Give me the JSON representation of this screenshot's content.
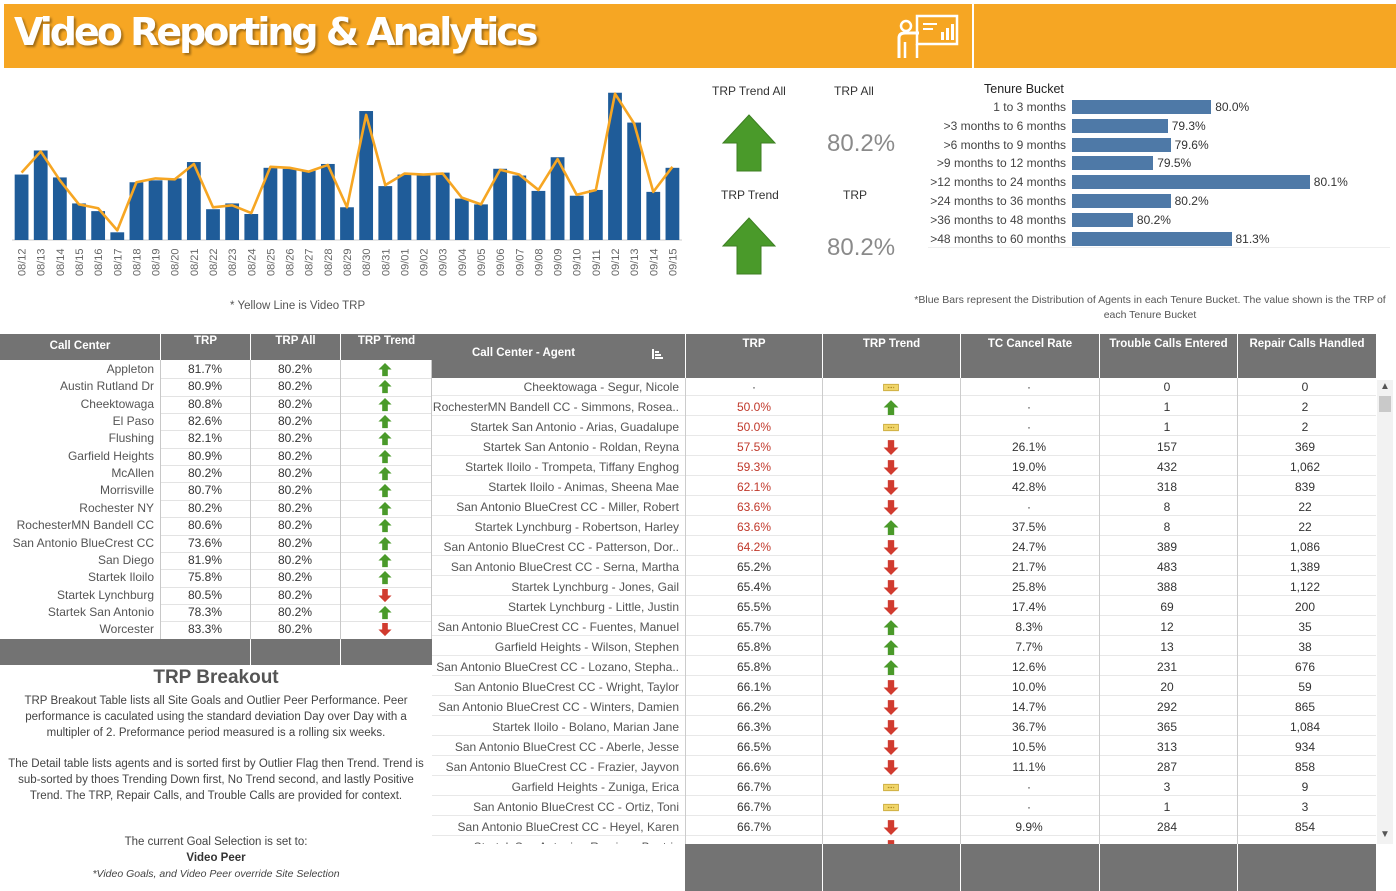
{
  "header": {
    "title": "Video Reporting & Analytics",
    "icon": "presentation-icon",
    "color": "#f6a623"
  },
  "trend_chart": {
    "note": "* Yellow Line is Video TRP",
    "bar_color": "#1f5c99",
    "line_color": "#f6a623",
    "dates": [
      "08/12",
      "08/13",
      "08/14",
      "08/15",
      "08/16",
      "08/17",
      "08/18",
      "08/19",
      "08/20",
      "08/21",
      "08/22",
      "08/23",
      "08/24",
      "08/25",
      "08/26",
      "08/27",
      "08/28",
      "08/29",
      "08/30",
      "08/31",
      "09/01",
      "09/02",
      "09/03",
      "09/04",
      "09/05",
      "09/06",
      "09/07",
      "09/08",
      "09/09",
      "09/10",
      "09/11",
      "09/12",
      "09/13",
      "09/14",
      "09/15"
    ],
    "bars": [
      68,
      93,
      65,
      38,
      30,
      8,
      60,
      62,
      64,
      81,
      32,
      38,
      27,
      75,
      74,
      72,
      79,
      34,
      134,
      56,
      68,
      68,
      70,
      43,
      37,
      74,
      67,
      51,
      86,
      46,
      52,
      153,
      122,
      50,
      75
    ],
    "line": [
      70,
      92,
      62,
      37,
      33,
      10,
      60,
      64,
      63,
      79,
      34,
      36,
      28,
      76,
      75,
      71,
      78,
      34,
      130,
      57,
      69,
      68,
      69,
      44,
      37,
      73,
      68,
      52,
      84,
      47,
      52,
      152,
      121,
      50,
      76
    ]
  },
  "kpis": {
    "trp_trend_all_label": "TRP Trend All",
    "trp_all_label": "TRP All",
    "trp_all_value": "80.2%",
    "trp_trend_label": "TRP Trend",
    "trp_label": "TRP",
    "trp_value": "80.2%"
  },
  "tenure": {
    "title": "Tenure Bucket",
    "note": "*Blue Bars represent the Distribution of Agents in each Tenure Bucket. The value shown is the TRP of each Tenure Bucket",
    "bar_color": "#4e79a7",
    "rows": [
      {
        "label": "1 to 3 months",
        "share": 0.48,
        "value": "80.0%"
      },
      {
        "label": ">3 months to 6 months",
        "share": 0.33,
        "value": "79.3%"
      },
      {
        "label": ">6 months to 9 months",
        "share": 0.34,
        "value": "79.6%"
      },
      {
        "label": ">9 months to 12 months",
        "share": 0.28,
        "value": "79.5%"
      },
      {
        "label": ">12 months  to 24 months",
        "share": 0.82,
        "value": "80.1%"
      },
      {
        "label": ">24 months to 36 months",
        "share": 0.34,
        "value": "80.2%"
      },
      {
        "label": ">36 months to 48 months",
        "share": 0.21,
        "value": "80.2%"
      },
      {
        "label": ">48 months to 60 months",
        "share": 0.55,
        "value": "81.3%"
      }
    ]
  },
  "call_center_table": {
    "headers": {
      "name": "Call Center",
      "trp": "TRP",
      "trp_all": "TRP All",
      "trend": "TRP Trend"
    },
    "rows": [
      {
        "name": "Appleton",
        "trp": "81.7%",
        "all": "80.2%",
        "trend": "up"
      },
      {
        "name": "Austin Rutland Dr",
        "trp": "80.9%",
        "all": "80.2%",
        "trend": "up"
      },
      {
        "name": "Cheektowaga",
        "trp": "80.8%",
        "all": "80.2%",
        "trend": "up"
      },
      {
        "name": "El Paso",
        "trp": "82.6%",
        "all": "80.2%",
        "trend": "up"
      },
      {
        "name": "Flushing",
        "trp": "82.1%",
        "all": "80.2%",
        "trend": "up"
      },
      {
        "name": "Garfield Heights",
        "trp": "80.9%",
        "all": "80.2%",
        "trend": "up"
      },
      {
        "name": "McAllen",
        "trp": "80.2%",
        "all": "80.2%",
        "trend": "up"
      },
      {
        "name": "Morrisville",
        "trp": "80.7%",
        "all": "80.2%",
        "trend": "up"
      },
      {
        "name": "Rochester NY",
        "trp": "80.2%",
        "all": "80.2%",
        "trend": "up"
      },
      {
        "name": "RochesterMN Bandell CC",
        "trp": "80.6%",
        "all": "80.2%",
        "trend": "up"
      },
      {
        "name": "San Antonio BlueCrest CC",
        "trp": "73.6%",
        "all": "80.2%",
        "trend": "up"
      },
      {
        "name": "San Diego",
        "trp": "81.9%",
        "all": "80.2%",
        "trend": "up"
      },
      {
        "name": "Startek Iloilo",
        "trp": "75.8%",
        "all": "80.2%",
        "trend": "up"
      },
      {
        "name": "Startek Lynchburg",
        "trp": "80.5%",
        "all": "80.2%",
        "trend": "down"
      },
      {
        "name": "Startek San Antonio",
        "trp": "78.3%",
        "all": "80.2%",
        "trend": "up"
      },
      {
        "name": "Worcester",
        "trp": "83.3%",
        "all": "80.2%",
        "trend": "down"
      }
    ]
  },
  "breakout": {
    "title": "TRP Breakout",
    "para1": "TRP Breakout Table lists all Site Goals and Outlier Peer Performance. Peer performance is caculated using the standard deviation Day over Day with a multipler of 2. Preformance period measured is a rolling six weeks.",
    "para2": "The Detail table lists agents and is sorted first by Outlier Flag then Trend. Trend is sub-sorted by thoes Trending Down first, No Trend second, and lastly Positive Trend. The TRP, Repair Calls, and Trouble Calls are provided for context.",
    "goal_label": "The current Goal Selection is set to:",
    "goal_value": "Video Peer",
    "override": "*Video Goals, and Video Peer override Site Selection"
  },
  "agent_table": {
    "headers": {
      "agent": "Call Center - Agent",
      "trp": "TRP",
      "trend": "TRP Trend",
      "cancel": "TC Cancel Rate",
      "entered": "Trouble Calls Entered",
      "handled": "Repair Calls Handled"
    },
    "rows": [
      {
        "name": "Cheektowaga  -  Segur, Nicole",
        "trp": "·",
        "red": false,
        "trend": "flat",
        "cancel": "·",
        "entered": "0",
        "handled": "0"
      },
      {
        "name": "RochesterMN Bandell CC  -  Simmons, Rosea..",
        "trp": "50.0%",
        "red": true,
        "trend": "up",
        "cancel": "·",
        "entered": "1",
        "handled": "2"
      },
      {
        "name": "Startek San Antonio  -  Arias, Guadalupe",
        "trp": "50.0%",
        "red": true,
        "trend": "flat",
        "cancel": "·",
        "entered": "1",
        "handled": "2"
      },
      {
        "name": "Startek San Antonio  -  Roldan, Reyna",
        "trp": "57.5%",
        "red": true,
        "trend": "down",
        "cancel": "26.1%",
        "entered": "157",
        "handled": "369"
      },
      {
        "name": "Startek Iloilo  -  Trompeta, Tiffany Enghog",
        "trp": "59.3%",
        "red": true,
        "trend": "down",
        "cancel": "19.0%",
        "entered": "432",
        "handled": "1,062"
      },
      {
        "name": "Startek Iloilo  -  Animas, Sheena Mae",
        "trp": "62.1%",
        "red": true,
        "trend": "down",
        "cancel": "42.8%",
        "entered": "318",
        "handled": "839"
      },
      {
        "name": "San Antonio BlueCrest CC  -  Miller, Robert",
        "trp": "63.6%",
        "red": true,
        "trend": "down",
        "cancel": "·",
        "entered": "8",
        "handled": "22"
      },
      {
        "name": "Startek Lynchburg  -  Robertson, Harley",
        "trp": "63.6%",
        "red": true,
        "trend": "up",
        "cancel": "37.5%",
        "entered": "8",
        "handled": "22"
      },
      {
        "name": "San Antonio BlueCrest CC  -  Patterson, Dor..",
        "trp": "64.2%",
        "red": true,
        "trend": "down",
        "cancel": "24.7%",
        "entered": "389",
        "handled": "1,086"
      },
      {
        "name": "San Antonio BlueCrest CC  -  Serna, Martha",
        "trp": "65.2%",
        "red": false,
        "trend": "down",
        "cancel": "21.7%",
        "entered": "483",
        "handled": "1,389"
      },
      {
        "name": "Startek Lynchburg  -  Jones, Gail",
        "trp": "65.4%",
        "red": false,
        "trend": "down",
        "cancel": "25.8%",
        "entered": "388",
        "handled": "1,122"
      },
      {
        "name": "Startek Lynchburg  -  Little, Justin",
        "trp": "65.5%",
        "red": false,
        "trend": "down",
        "cancel": "17.4%",
        "entered": "69",
        "handled": "200"
      },
      {
        "name": "San Antonio BlueCrest CC  -  Fuentes, Manuel",
        "trp": "65.7%",
        "red": false,
        "trend": "up",
        "cancel": "8.3%",
        "entered": "12",
        "handled": "35"
      },
      {
        "name": "Garfield Heights  -  Wilson, Stephen",
        "trp": "65.8%",
        "red": false,
        "trend": "up",
        "cancel": "7.7%",
        "entered": "13",
        "handled": "38"
      },
      {
        "name": "San Antonio BlueCrest CC  -  Lozano, Stepha..",
        "trp": "65.8%",
        "red": false,
        "trend": "up",
        "cancel": "12.6%",
        "entered": "231",
        "handled": "676"
      },
      {
        "name": "San Antonio BlueCrest CC  -  Wright, Taylor",
        "trp": "66.1%",
        "red": false,
        "trend": "down",
        "cancel": "10.0%",
        "entered": "20",
        "handled": "59"
      },
      {
        "name": "San Antonio BlueCrest CC  -  Winters, Damien",
        "trp": "66.2%",
        "red": false,
        "trend": "down",
        "cancel": "14.7%",
        "entered": "292",
        "handled": "865"
      },
      {
        "name": "Startek Iloilo  -  Bolano, Marian Jane",
        "trp": "66.3%",
        "red": false,
        "trend": "down",
        "cancel": "36.7%",
        "entered": "365",
        "handled": "1,084"
      },
      {
        "name": "San Antonio BlueCrest CC  -  Aberle, Jesse",
        "trp": "66.5%",
        "red": false,
        "trend": "down",
        "cancel": "10.5%",
        "entered": "313",
        "handled": "934"
      },
      {
        "name": "San Antonio BlueCrest CC  -  Frazier, Jayvon",
        "trp": "66.6%",
        "red": false,
        "trend": "down",
        "cancel": "11.1%",
        "entered": "287",
        "handled": "858"
      },
      {
        "name": "Garfield Heights  -  Zuniga, Erica",
        "trp": "66.7%",
        "red": false,
        "trend": "flat",
        "cancel": "·",
        "entered": "3",
        "handled": "9"
      },
      {
        "name": "San Antonio BlueCrest CC  -  Ortiz, Toni",
        "trp": "66.7%",
        "red": false,
        "trend": "flat",
        "cancel": "·",
        "entered": "1",
        "handled": "3"
      },
      {
        "name": "San Antonio BlueCrest CC  -  Heyel, Karen",
        "trp": "66.7%",
        "red": false,
        "trend": "down",
        "cancel": "9.9%",
        "entered": "284",
        "handled": "854"
      },
      {
        "name": "Startek San Antonio  -  Ramirez, Beatriz",
        "trp": "",
        "red": false,
        "trend": "down",
        "cancel": "",
        "entered": "",
        "handled": ""
      }
    ]
  },
  "colors": {
    "up": "#4a9a2a",
    "down": "#d13b2f",
    "flat": "#f0d56a",
    "header_gray": "#737373"
  }
}
